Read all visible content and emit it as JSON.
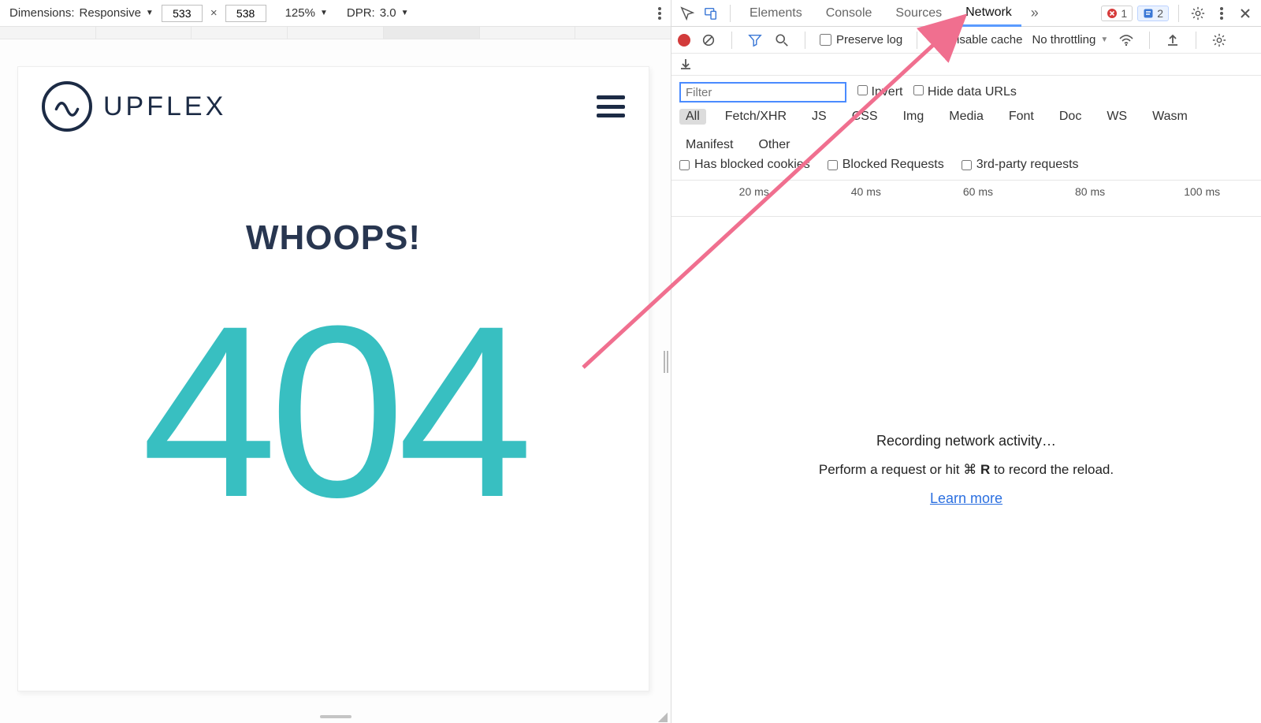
{
  "device_toolbar": {
    "dimensions_label": "Dimensions:",
    "dimensions_value": "Responsive",
    "width": "533",
    "height": "538",
    "between": "×",
    "zoom": "125%",
    "dpr_label": "DPR:",
    "dpr_value": "3.0"
  },
  "preview": {
    "brand": "UPFLEX",
    "whoops": "WHOOPS!",
    "code": "404"
  },
  "devtools": {
    "tabs": {
      "elements": "Elements",
      "console": "Console",
      "sources": "Sources",
      "network": "Network",
      "more": "»"
    },
    "badges": {
      "errors": "1",
      "info": "2"
    }
  },
  "net_toolbar": {
    "preserve_log": "Preserve log",
    "disable_cache": "Disable cache",
    "throttling": "No throttling"
  },
  "filter": {
    "placeholder": "Filter",
    "invert": "Invert",
    "hide_data_urls": "Hide data URLs",
    "types": [
      "All",
      "Fetch/XHR",
      "JS",
      "CSS",
      "Img",
      "Media",
      "Font",
      "Doc",
      "WS",
      "Wasm",
      "Manifest",
      "Other"
    ],
    "has_blocked_cookies": "Has blocked cookies",
    "blocked_requests": "Blocked Requests",
    "third_party": "3rd-party requests"
  },
  "timeline": {
    "ticks": [
      "20 ms",
      "40 ms",
      "60 ms",
      "80 ms",
      "100 ms"
    ]
  },
  "empty": {
    "title": "Recording network activity…",
    "sub_pre": "Perform a request or hit ",
    "sub_cmd": "⌘",
    "sub_key": "R",
    "sub_post": " to record the reload.",
    "learn_more": "Learn more"
  }
}
